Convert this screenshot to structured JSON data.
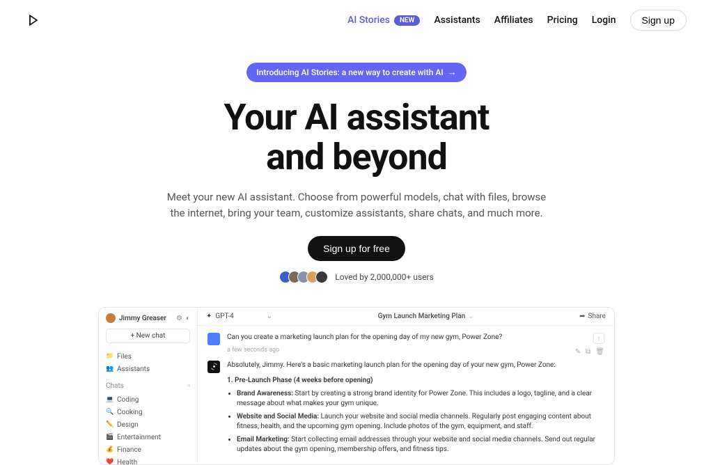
{
  "nav": {
    "items": [
      {
        "label": "AI Stories",
        "badge": "NEW",
        "active": true
      },
      {
        "label": "Assistants"
      },
      {
        "label": "Affiliates"
      },
      {
        "label": "Pricing"
      },
      {
        "label": "Login"
      }
    ],
    "signup": "Sign up"
  },
  "hero": {
    "announce": "Introducing AI Stories: a new way to create with AI",
    "title_l1": "Your AI assistant",
    "title_l2": "and beyond",
    "sub": "Meet your new AI assistant. Choose from powerful models, chat with files, browse the internet, bring your team, customize assistants, share chats, and much more.",
    "cta": "Sign up for free",
    "social": "Loved by 2,000,000+ users",
    "avatar_colors": [
      "#3b5fc9",
      "#7a6a58",
      "#8893a8",
      "#d8a05a",
      "#3a3a3a"
    ]
  },
  "preview": {
    "user": "Jimmy Greaser",
    "newchat": "+  New chat",
    "nav_items": [
      {
        "icon": "📁",
        "label": "Files"
      },
      {
        "icon": "👥",
        "label": "Assistants"
      }
    ],
    "chats_label": "Chats",
    "chat_items": [
      {
        "icon": "💻",
        "label": "Coding"
      },
      {
        "icon": "🔍",
        "label": "Cooking"
      },
      {
        "icon": "✏️",
        "label": "Design"
      },
      {
        "icon": "🎬",
        "label": "Entertainment"
      },
      {
        "icon": "💰",
        "label": "Finance"
      },
      {
        "icon": "❤️",
        "label": "Health"
      }
    ],
    "model": "GPT-4",
    "plan": "Gym Launch Marketing Plan",
    "share": "Share",
    "user_msg": "Can you create a marketing launch plan for the opening day of my new gym, Power Zone?",
    "user_time": "a few seconds ago",
    "ai_intro": "Absolutely, Jimmy. Here's a basic marketing launch plan for the opening day of your new gym, Power Zone:",
    "ai_h1": "1. Pre-Launch Phase (4 weeks before opening)",
    "bullets": [
      {
        "b": "Brand Awareness:",
        "t": " Start by creating a strong brand identity for Power Zone. This includes a logo, tagline, and a clear message about what makes your gym unique."
      },
      {
        "b": "Website and Social Media:",
        "t": " Launch your website and social media channels. Regularly post engaging content about fitness, health, and the upcoming gym opening. Include photos of the gym, equipment, and staff."
      },
      {
        "b": "Email Marketing:",
        "t": " Start collecting email addresses through your website and social media channels. Send out regular updates about the gym opening, membership offers, and fitness tips."
      }
    ]
  }
}
